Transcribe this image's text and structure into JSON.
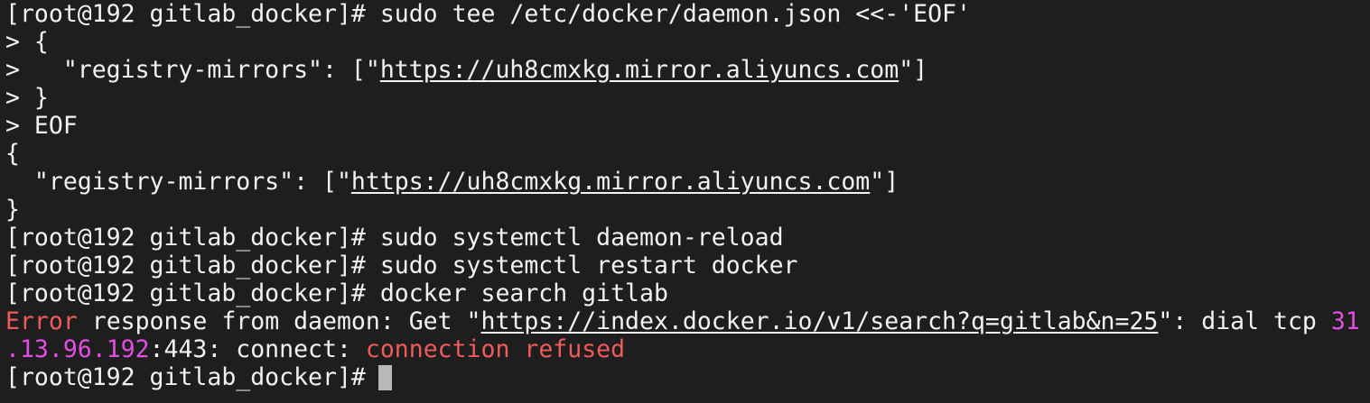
{
  "terminal": {
    "prompt": "[root@192 gitlab_docker]#",
    "lines": [
      {
        "cmd": " sudo tee /etc/docker/daemon.json <<-'EOF'"
      },
      {
        "text": "> {"
      },
      {
        "pre": ">   \"registry-mirrors\": [\"",
        "link": "https://uh8cmxkg.mirror.aliyuncs.com",
        "post": "\"]"
      },
      {
        "text": "> }"
      },
      {
        "text": "> EOF"
      },
      {
        "text": "{"
      },
      {
        "pre": "  \"registry-mirrors\": [\"",
        "link": "https://uh8cmxkg.mirror.aliyuncs.com",
        "post": "\"]"
      },
      {
        "text": "}"
      },
      {
        "cmd": " sudo systemctl daemon-reload"
      },
      {
        "cmd": " sudo systemctl restart docker"
      },
      {
        "cmd": " docker search gitlab"
      }
    ],
    "error": {
      "label": "Error",
      "message": " response from daemon: Get \"",
      "url": "https://index.docker.io/v1/search?q=gitlab&n=25",
      "mid": "\": dial tcp ",
      "ip_part1": "31",
      "ip_part2": ".13.96.192",
      "port_text": ":443: connect: ",
      "refused": "connection refused"
    }
  },
  "colors": {
    "background": "#1e1e1e",
    "foreground": "#f2f2f2",
    "error": "#f05a5a",
    "ip": "#e24ee2",
    "cursor": "#b8b8b8"
  }
}
